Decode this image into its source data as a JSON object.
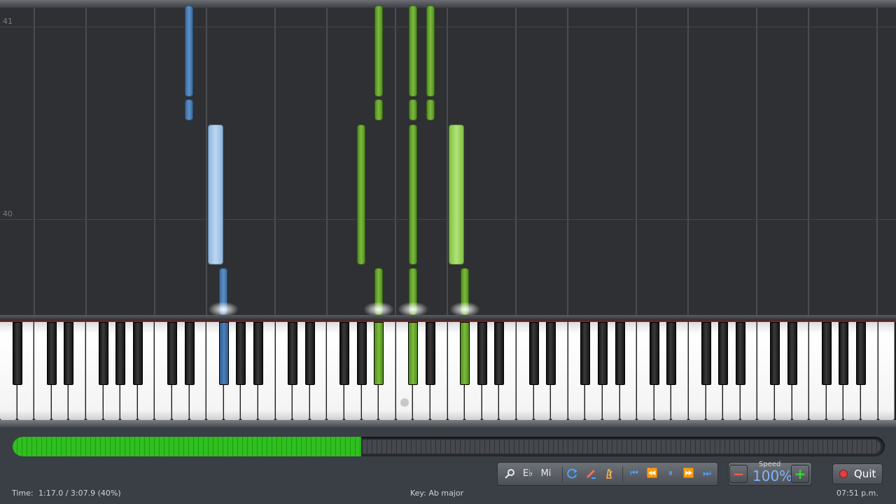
{
  "roll": {
    "measure_labels": [
      "41",
      "40"
    ]
  },
  "progress": {
    "fraction": 0.4
  },
  "toolbar": {
    "zoom_icon": "magnifier-icon",
    "key_signature_label": "E♭",
    "solfege_label": "Mi",
    "loop_icon": "loop-icon",
    "hand_icon": "pencil-icon",
    "metronome_icon": "metronome-icon",
    "skip_back_icon": "⏮",
    "rewind_icon": "⏪",
    "pause_icon": "⏸",
    "fast_forward_icon": "⏩",
    "skip_end_icon": "⏭"
  },
  "speed": {
    "label": "Speed",
    "value": "100%",
    "minus": "−",
    "plus": "+"
  },
  "quit": {
    "label": "Quit"
  },
  "status": {
    "time_label": "Time:",
    "time_value": "1:17.0 / 3:07.9 (40%)",
    "key": "Key: Ab major",
    "clock": "07:51 p.m."
  },
  "colors": {
    "left_hand": "#4d80b8",
    "right_hand": "#7dbb3d",
    "progress": "#2fbf1f"
  }
}
